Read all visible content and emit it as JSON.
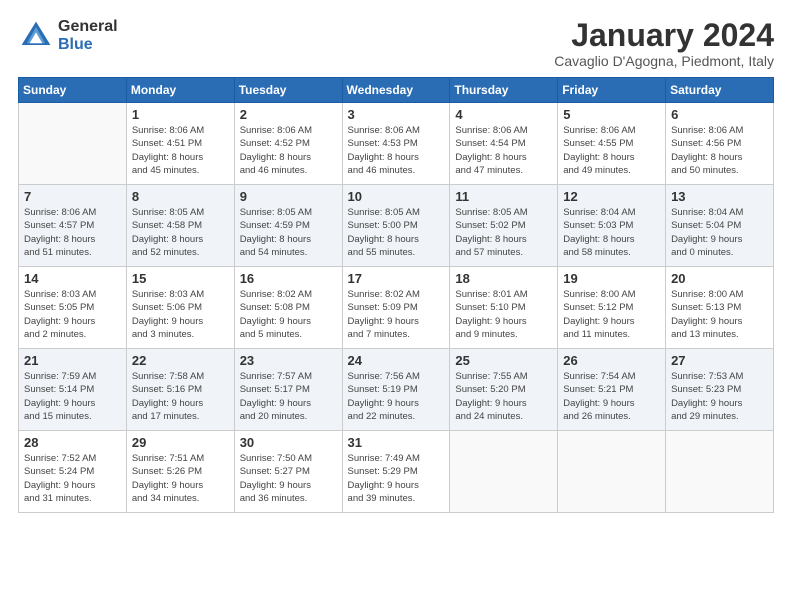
{
  "logo": {
    "general": "General",
    "blue": "Blue"
  },
  "title": "January 2024",
  "subtitle": "Cavaglio D'Agogna, Piedmont, Italy",
  "headers": [
    "Sunday",
    "Monday",
    "Tuesday",
    "Wednesday",
    "Thursday",
    "Friday",
    "Saturday"
  ],
  "weeks": [
    [
      {
        "day": "",
        "info": ""
      },
      {
        "day": "1",
        "info": "Sunrise: 8:06 AM\nSunset: 4:51 PM\nDaylight: 8 hours\nand 45 minutes."
      },
      {
        "day": "2",
        "info": "Sunrise: 8:06 AM\nSunset: 4:52 PM\nDaylight: 8 hours\nand 46 minutes."
      },
      {
        "day": "3",
        "info": "Sunrise: 8:06 AM\nSunset: 4:53 PM\nDaylight: 8 hours\nand 46 minutes."
      },
      {
        "day": "4",
        "info": "Sunrise: 8:06 AM\nSunset: 4:54 PM\nDaylight: 8 hours\nand 47 minutes."
      },
      {
        "day": "5",
        "info": "Sunrise: 8:06 AM\nSunset: 4:55 PM\nDaylight: 8 hours\nand 49 minutes."
      },
      {
        "day": "6",
        "info": "Sunrise: 8:06 AM\nSunset: 4:56 PM\nDaylight: 8 hours\nand 50 minutes."
      }
    ],
    [
      {
        "day": "7",
        "info": "Sunrise: 8:06 AM\nSunset: 4:57 PM\nDaylight: 8 hours\nand 51 minutes."
      },
      {
        "day": "8",
        "info": "Sunrise: 8:05 AM\nSunset: 4:58 PM\nDaylight: 8 hours\nand 52 minutes."
      },
      {
        "day": "9",
        "info": "Sunrise: 8:05 AM\nSunset: 4:59 PM\nDaylight: 8 hours\nand 54 minutes."
      },
      {
        "day": "10",
        "info": "Sunrise: 8:05 AM\nSunset: 5:00 PM\nDaylight: 8 hours\nand 55 minutes."
      },
      {
        "day": "11",
        "info": "Sunrise: 8:05 AM\nSunset: 5:02 PM\nDaylight: 8 hours\nand 57 minutes."
      },
      {
        "day": "12",
        "info": "Sunrise: 8:04 AM\nSunset: 5:03 PM\nDaylight: 8 hours\nand 58 minutes."
      },
      {
        "day": "13",
        "info": "Sunrise: 8:04 AM\nSunset: 5:04 PM\nDaylight: 9 hours\nand 0 minutes."
      }
    ],
    [
      {
        "day": "14",
        "info": "Sunrise: 8:03 AM\nSunset: 5:05 PM\nDaylight: 9 hours\nand 2 minutes."
      },
      {
        "day": "15",
        "info": "Sunrise: 8:03 AM\nSunset: 5:06 PM\nDaylight: 9 hours\nand 3 minutes."
      },
      {
        "day": "16",
        "info": "Sunrise: 8:02 AM\nSunset: 5:08 PM\nDaylight: 9 hours\nand 5 minutes."
      },
      {
        "day": "17",
        "info": "Sunrise: 8:02 AM\nSunset: 5:09 PM\nDaylight: 9 hours\nand 7 minutes."
      },
      {
        "day": "18",
        "info": "Sunrise: 8:01 AM\nSunset: 5:10 PM\nDaylight: 9 hours\nand 9 minutes."
      },
      {
        "day": "19",
        "info": "Sunrise: 8:00 AM\nSunset: 5:12 PM\nDaylight: 9 hours\nand 11 minutes."
      },
      {
        "day": "20",
        "info": "Sunrise: 8:00 AM\nSunset: 5:13 PM\nDaylight: 9 hours\nand 13 minutes."
      }
    ],
    [
      {
        "day": "21",
        "info": "Sunrise: 7:59 AM\nSunset: 5:14 PM\nDaylight: 9 hours\nand 15 minutes."
      },
      {
        "day": "22",
        "info": "Sunrise: 7:58 AM\nSunset: 5:16 PM\nDaylight: 9 hours\nand 17 minutes."
      },
      {
        "day": "23",
        "info": "Sunrise: 7:57 AM\nSunset: 5:17 PM\nDaylight: 9 hours\nand 20 minutes."
      },
      {
        "day": "24",
        "info": "Sunrise: 7:56 AM\nSunset: 5:19 PM\nDaylight: 9 hours\nand 22 minutes."
      },
      {
        "day": "25",
        "info": "Sunrise: 7:55 AM\nSunset: 5:20 PM\nDaylight: 9 hours\nand 24 minutes."
      },
      {
        "day": "26",
        "info": "Sunrise: 7:54 AM\nSunset: 5:21 PM\nDaylight: 9 hours\nand 26 minutes."
      },
      {
        "day": "27",
        "info": "Sunrise: 7:53 AM\nSunset: 5:23 PM\nDaylight: 9 hours\nand 29 minutes."
      }
    ],
    [
      {
        "day": "28",
        "info": "Sunrise: 7:52 AM\nSunset: 5:24 PM\nDaylight: 9 hours\nand 31 minutes."
      },
      {
        "day": "29",
        "info": "Sunrise: 7:51 AM\nSunset: 5:26 PM\nDaylight: 9 hours\nand 34 minutes."
      },
      {
        "day": "30",
        "info": "Sunrise: 7:50 AM\nSunset: 5:27 PM\nDaylight: 9 hours\nand 36 minutes."
      },
      {
        "day": "31",
        "info": "Sunrise: 7:49 AM\nSunset: 5:29 PM\nDaylight: 9 hours\nand 39 minutes."
      },
      {
        "day": "",
        "info": ""
      },
      {
        "day": "",
        "info": ""
      },
      {
        "day": "",
        "info": ""
      }
    ]
  ]
}
